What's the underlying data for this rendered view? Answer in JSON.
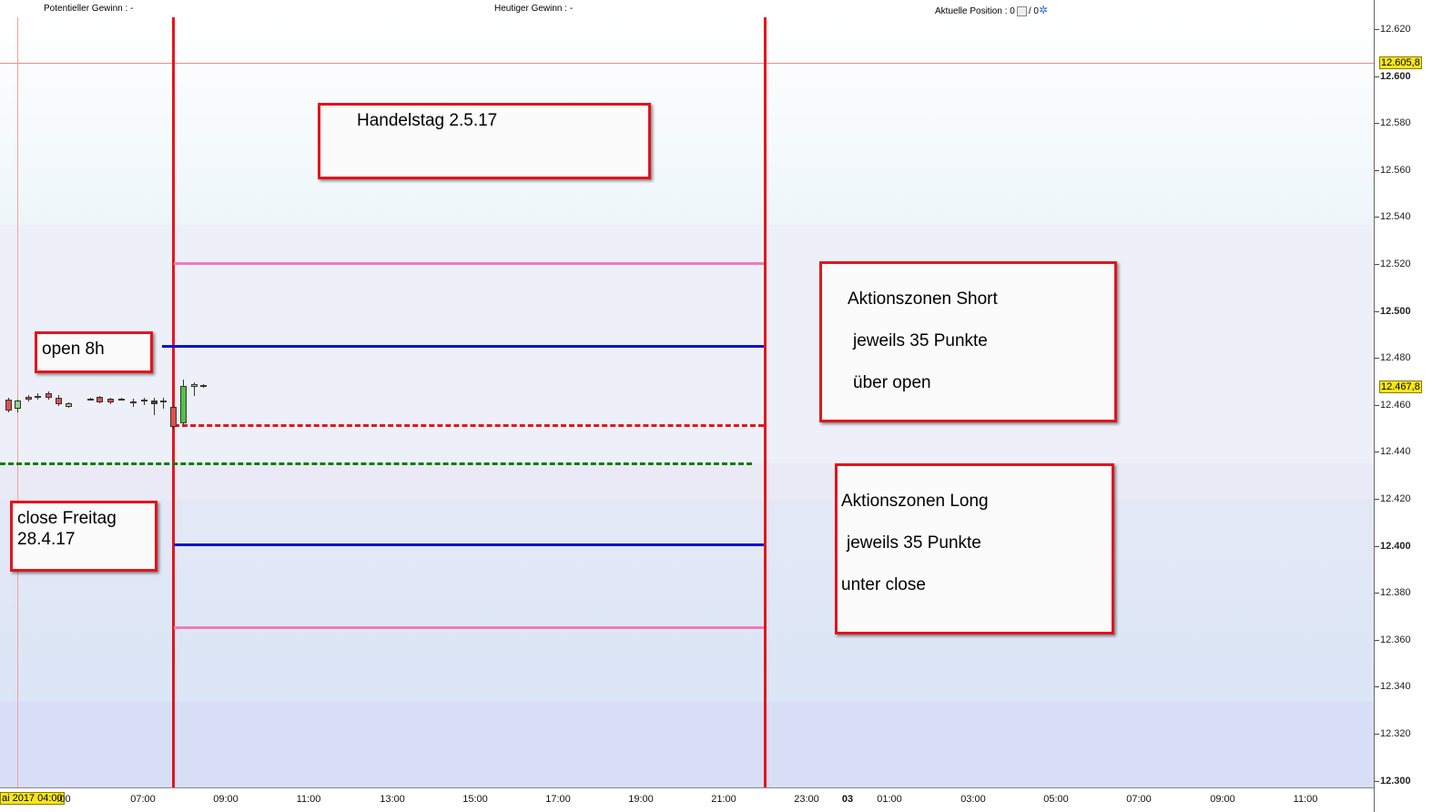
{
  "header": {
    "potential_gain": "Potentieller Gewinn : -",
    "today_gain": "Heutiger Gewinn : -",
    "position_label": "Aktuelle Position : 0",
    "position_sep": "/ 0"
  },
  "y_axis": {
    "ticks": [
      "12.620",
      "12.600",
      "12.580",
      "12.560",
      "12.540",
      "12.520",
      "12.500",
      "12.480",
      "12.460",
      "12.440",
      "12.420",
      "12.400",
      "12.380",
      "12.360",
      "12.340",
      "12.320",
      "12.300"
    ],
    "bold_ticks": [
      "12.600",
      "12.500",
      "12.400",
      "12.300"
    ],
    "crosshair_price": "12.605,8",
    "last_price": "12.467,8"
  },
  "x_axis": {
    "date_badge": "ai 2017 04:00",
    "date_tail": ":00",
    "ticks": [
      "07:00",
      "09:00",
      "11:00",
      "13:00",
      "15:00",
      "17:00",
      "19:00",
      "21:00",
      "23:00",
      "03",
      "01:00",
      "03:00",
      "05:00",
      "07:00",
      "09:00",
      "11:00"
    ],
    "bold_tick": "03"
  },
  "annotations": {
    "handelstag": "Handelstag 2.5.17",
    "open": "open 8h",
    "close_line1": "close Freitag",
    "close_line2": "28.4.17",
    "short_line1": "Aktionszonen Short",
    "short_line2": "jeweils 35 Punkte",
    "short_line3": "über open",
    "long_line1": "Aktionszonen Long",
    "long_line2": "jeweils 35 Punkte",
    "long_line3": "unter close"
  },
  "colors": {
    "red": "#e8141a",
    "blue": "#0a14d4",
    "pink": "#f07ab8",
    "green": "#0f7d12",
    "badge": "#f6e51a",
    "gear": "#2a6fd6"
  },
  "icons": {
    "gear": "gear-icon",
    "box": "settings-box-icon"
  }
}
